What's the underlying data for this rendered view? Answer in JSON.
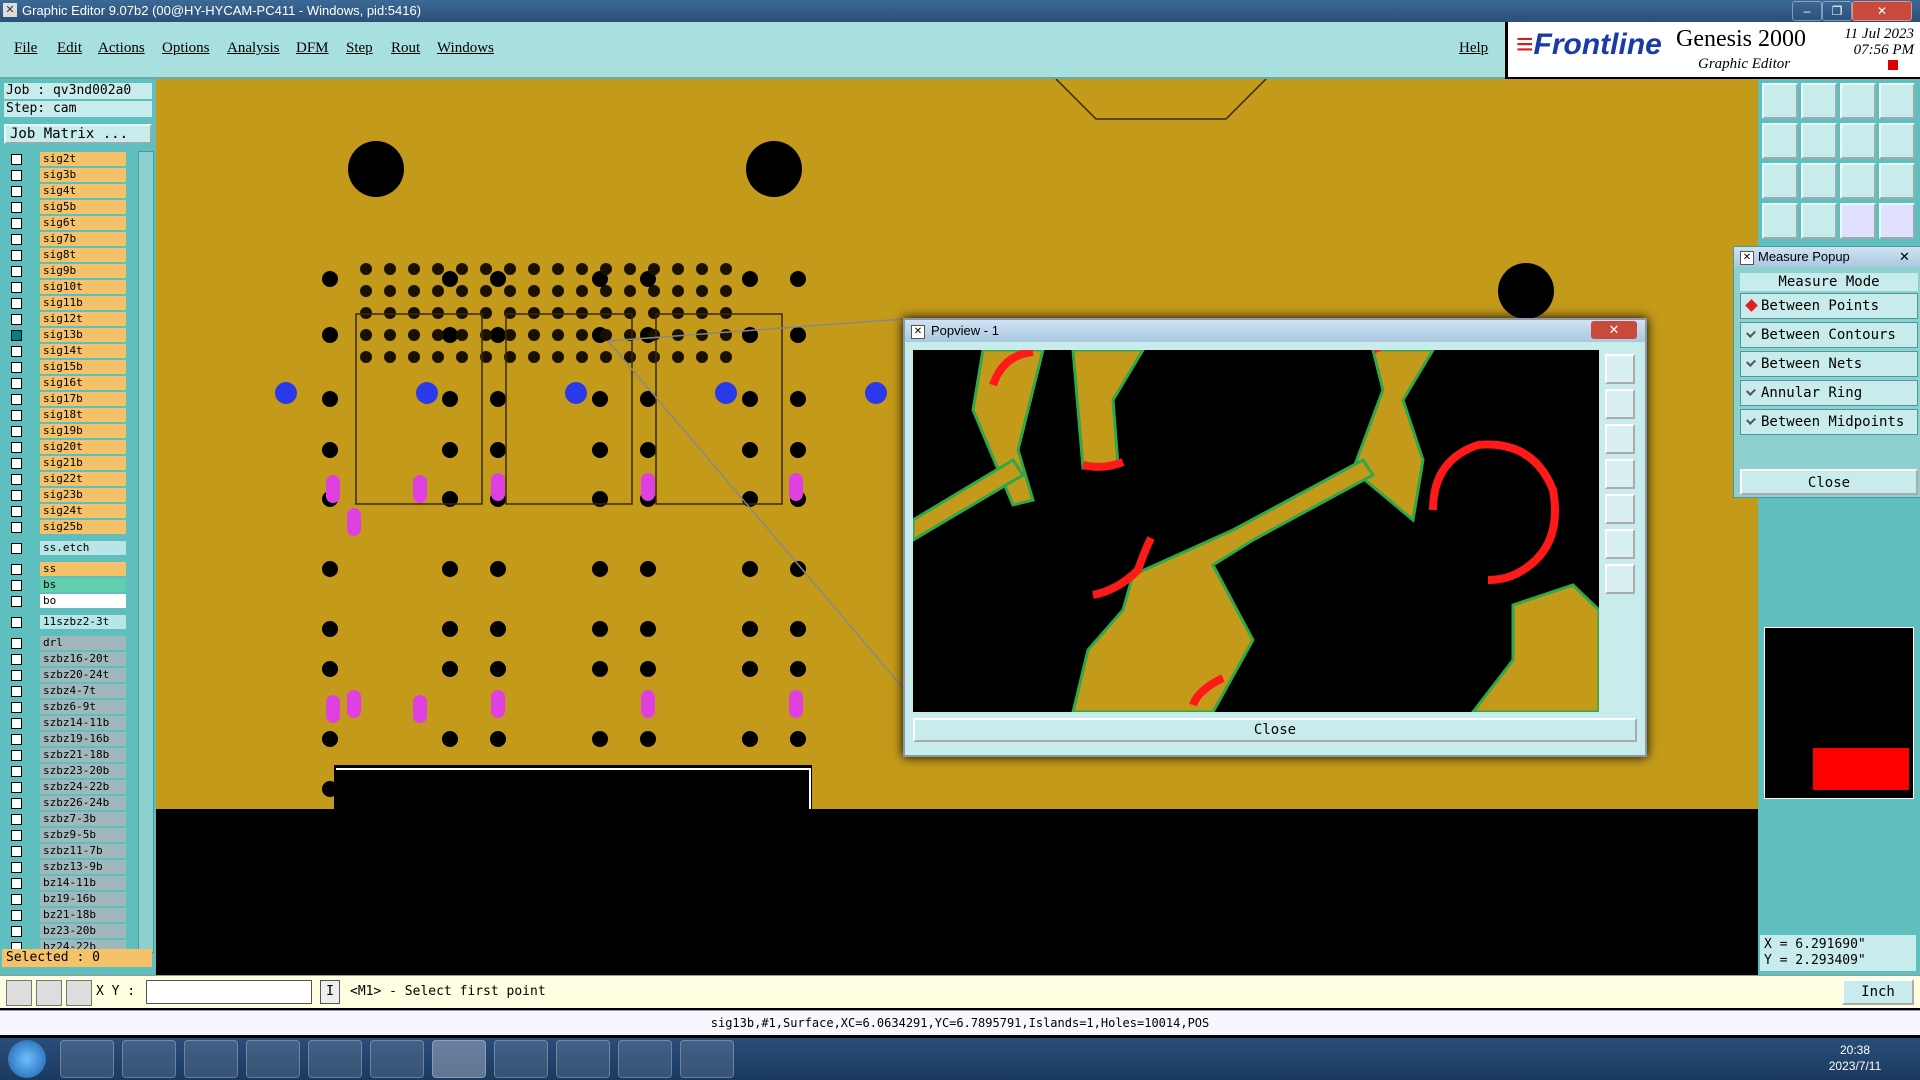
{
  "window": {
    "title": "Graphic Editor 9.07b2 (00@HY-HYCAM-PC411 - Windows, pid:5416)"
  },
  "menu": {
    "items": [
      "File",
      "Edit",
      "Actions",
      "Options",
      "Analysis",
      "DFM",
      "Step",
      "Rout",
      "Windows"
    ],
    "help": "Help"
  },
  "brand": {
    "company": "Frontline",
    "product": "Genesis 2000",
    "subtitle": "Graphic Editor",
    "date": "11 Jul 2023",
    "time": "07:56 PM"
  },
  "job": {
    "job_label": "Job : qv3nd002a0",
    "step_label": "Step: cam",
    "matrix_button": "Job Matrix ..."
  },
  "layers": [
    {
      "name": "sig2t",
      "color": "y"
    },
    {
      "name": "sig3b",
      "color": "y"
    },
    {
      "name": "sig4t",
      "color": "y"
    },
    {
      "name": "sig5b",
      "color": "y"
    },
    {
      "name": "sig6t",
      "color": "y"
    },
    {
      "name": "sig7b",
      "color": "y"
    },
    {
      "name": "sig8t",
      "color": "y"
    },
    {
      "name": "sig9b",
      "color": "y"
    },
    {
      "name": "sig10t",
      "color": "y"
    },
    {
      "name": "sig11b",
      "color": "y"
    },
    {
      "name": "sig12t",
      "color": "y"
    },
    {
      "name": "sig13b",
      "color": "y",
      "selected": true
    },
    {
      "name": "sig14t",
      "color": "y"
    },
    {
      "name": "sig15b",
      "color": "y"
    },
    {
      "name": "sig16t",
      "color": "y"
    },
    {
      "name": "sig17b",
      "color": "y"
    },
    {
      "name": "sig18t",
      "color": "y"
    },
    {
      "name": "sig19b",
      "color": "y"
    },
    {
      "name": "sig20t",
      "color": "y"
    },
    {
      "name": "sig21b",
      "color": "y"
    },
    {
      "name": "sig22t",
      "color": "y"
    },
    {
      "name": "sig23b",
      "color": "y"
    },
    {
      "name": "sig24t",
      "color": "y"
    },
    {
      "name": "sig25b",
      "color": "y"
    },
    {
      "name": "ss.etch",
      "color": "b",
      "gap": true
    },
    {
      "name": "ss",
      "color": "y",
      "gap": true
    },
    {
      "name": "bs",
      "color": "t"
    },
    {
      "name": "bo",
      "color": "w"
    },
    {
      "name": "11szbz2-3t",
      "color": "b",
      "gap": true
    },
    {
      "name": "drl",
      "color": "g",
      "gap": true
    },
    {
      "name": "szbz16-20t",
      "color": "g"
    },
    {
      "name": "szbz20-24t",
      "color": "g"
    },
    {
      "name": "szbz4-7t",
      "color": "g"
    },
    {
      "name": "szbz6-9t",
      "color": "g"
    },
    {
      "name": "szbz14-11b",
      "color": "g"
    },
    {
      "name": "szbz19-16b",
      "color": "g"
    },
    {
      "name": "szbz21-18b",
      "color": "g"
    },
    {
      "name": "szbz23-20b",
      "color": "g"
    },
    {
      "name": "szbz24-22b",
      "color": "g"
    },
    {
      "name": "szbz26-24b",
      "color": "g"
    },
    {
      "name": "szbz7-3b",
      "color": "g"
    },
    {
      "name": "szbz9-5b",
      "color": "g"
    },
    {
      "name": "szbz11-7b",
      "color": "g"
    },
    {
      "name": "szbz13-9b",
      "color": "g"
    },
    {
      "name": "bz14-11b",
      "color": "g"
    },
    {
      "name": "bz19-16b",
      "color": "g"
    },
    {
      "name": "bz21-18b",
      "color": "g"
    },
    {
      "name": "bz23-20b",
      "color": "g"
    },
    {
      "name": "bz24-22b",
      "color": "g"
    }
  ],
  "selected_label": "Selected : 0",
  "measure": {
    "title": "Measure Popup",
    "header": "Measure Mode",
    "modes": [
      "Between Points",
      "Between Contours",
      "Between Nets",
      "Annular Ring",
      "Between Midpoints"
    ],
    "close": "Close"
  },
  "popview": {
    "title": "Popview - 1",
    "close": "Close"
  },
  "coords": {
    "x": "X = 6.291690\"",
    "y": "Y = 2.293409\""
  },
  "command": {
    "xy_label": "X Y :",
    "prompt": "<M1> - Select first point",
    "unit": "Inch"
  },
  "status": {
    "text": "sig13b,#1,Surface,XC=6.0634291,YC=6.7895791,Islands=1,Holes=10014,POS"
  },
  "taskbar": {
    "time": "20:38",
    "date": "2023/7/11"
  },
  "colors": {
    "board": "#c49a1a",
    "panel": "#5fbfbf",
    "accent_red": "#ff1a1a",
    "magenta": "#e040e0",
    "pad_blue": "#2a3ae8"
  }
}
